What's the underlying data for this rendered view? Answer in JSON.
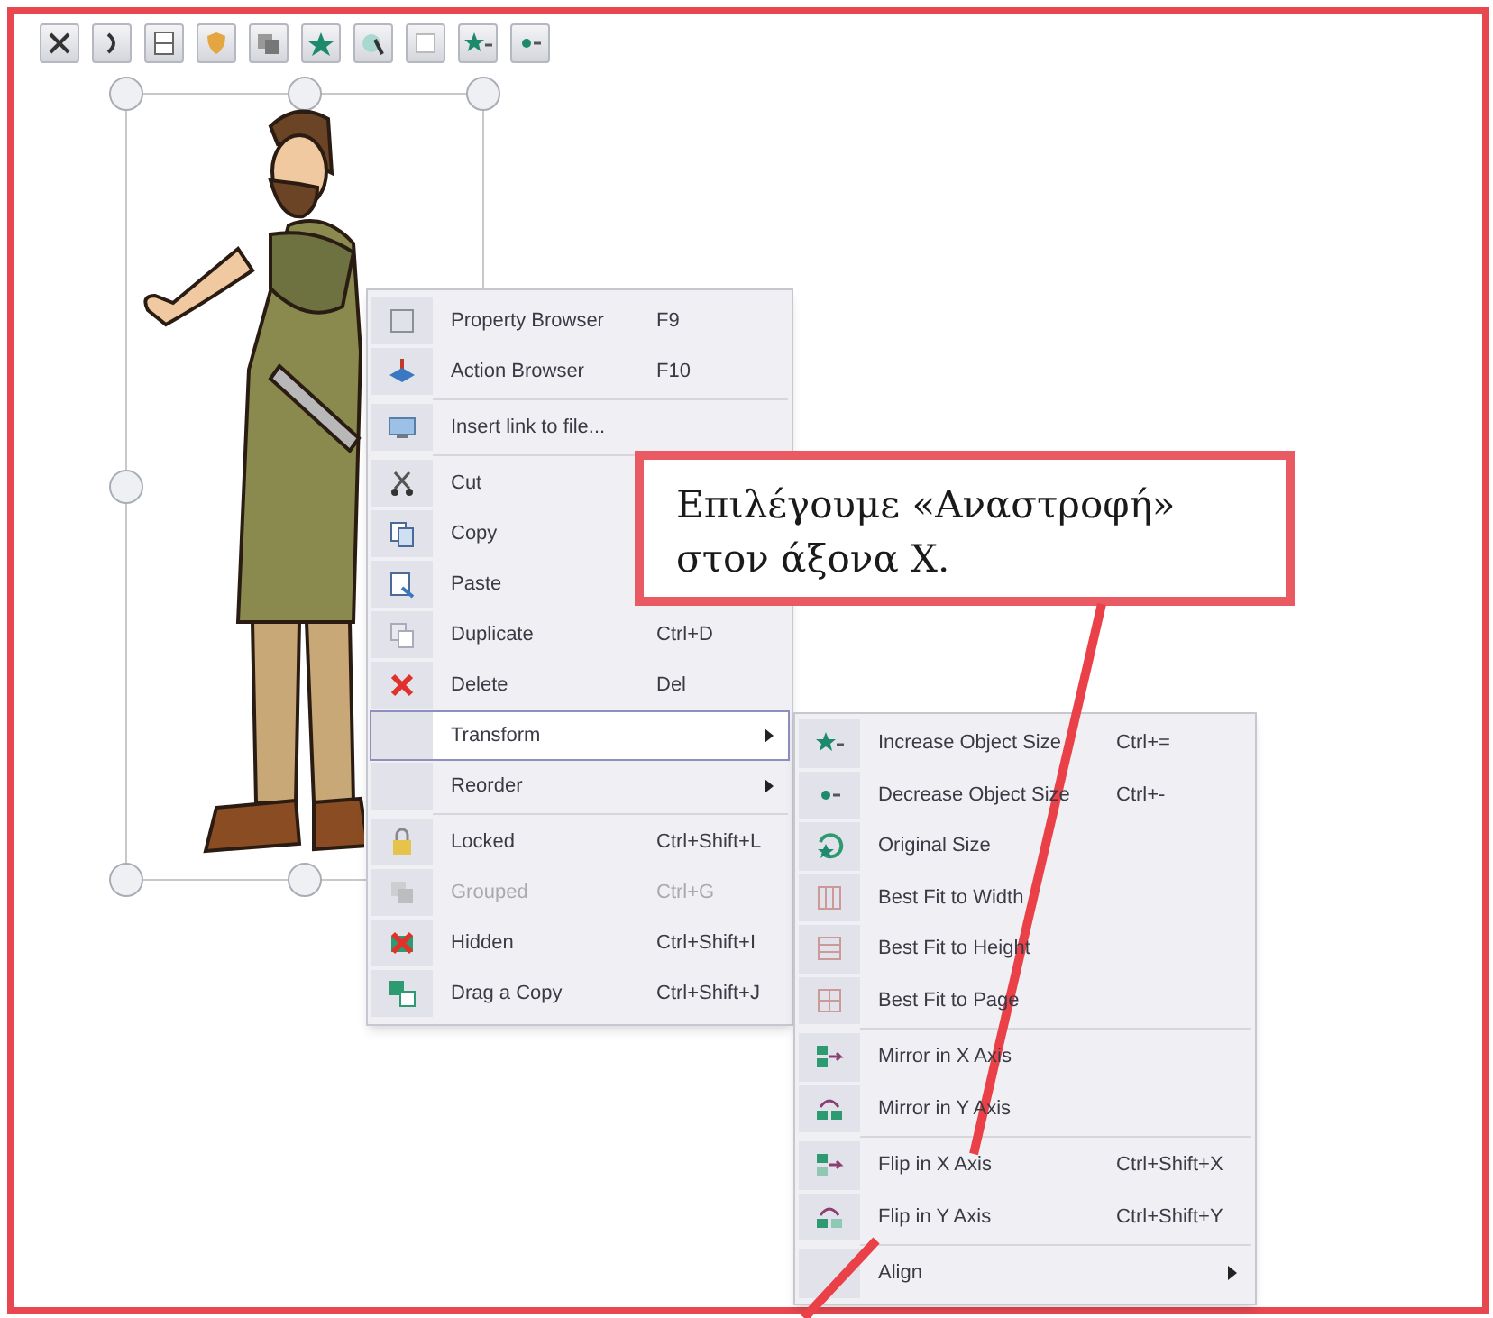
{
  "menu": {
    "items": [
      {
        "kind": "item",
        "label": "Property Browser",
        "shortcut": "F9",
        "disabled": false,
        "selected": false
      },
      {
        "kind": "item",
        "label": "Action Browser",
        "shortcut": "F10",
        "disabled": false,
        "selected": false
      },
      {
        "kind": "separator"
      },
      {
        "kind": "item",
        "label": "Insert link to file...",
        "disabled": false,
        "selected": false
      },
      {
        "kind": "separator"
      },
      {
        "kind": "item",
        "label": "Cut",
        "disabled": false,
        "selected": false
      },
      {
        "kind": "item",
        "label": "Copy",
        "disabled": false,
        "selected": false
      },
      {
        "kind": "item",
        "label": "Paste",
        "disabled": false,
        "selected": false
      },
      {
        "kind": "item",
        "label": "Duplicate",
        "shortcut": "Ctrl+D",
        "disabled": false,
        "selected": false
      },
      {
        "kind": "item",
        "label": "Delete",
        "shortcut": "Del",
        "disabled": false,
        "selected": false
      },
      {
        "kind": "item",
        "label": "Transform",
        "disabled": false,
        "selected": true,
        "submenu": true
      },
      {
        "kind": "item",
        "label": "Reorder",
        "disabled": false,
        "selected": false,
        "submenu": true
      },
      {
        "kind": "separator"
      },
      {
        "kind": "item",
        "label": "Locked",
        "shortcut": "Ctrl+Shift+L",
        "disabled": false,
        "selected": false
      },
      {
        "kind": "item",
        "label": "Grouped",
        "shortcut": "Ctrl+G",
        "disabled": true,
        "selected": false
      },
      {
        "kind": "item",
        "label": "Hidden",
        "shortcut": "Ctrl+Shift+I",
        "disabled": false,
        "selected": false
      },
      {
        "kind": "item",
        "label": "Drag a Copy",
        "shortcut": "Ctrl+Shift+J",
        "disabled": false,
        "selected": false
      }
    ]
  },
  "submenu": {
    "items": [
      {
        "kind": "item",
        "label": "Increase Object Size",
        "shortcut": "Ctrl+="
      },
      {
        "kind": "item",
        "label": "Decrease Object Size",
        "shortcut": "Ctrl+-"
      },
      {
        "kind": "item",
        "label": "Original Size"
      },
      {
        "kind": "item",
        "label": "Best Fit to Width"
      },
      {
        "kind": "item",
        "label": "Best Fit to Height"
      },
      {
        "kind": "item",
        "label": "Best Fit to Page"
      },
      {
        "kind": "separator"
      },
      {
        "kind": "item",
        "label": "Mirror in X Axis"
      },
      {
        "kind": "item",
        "label": "Mirror in Y Axis"
      },
      {
        "kind": "separator"
      },
      {
        "kind": "item",
        "label": "Flip in X Axis",
        "shortcut": "Ctrl+Shift+X"
      },
      {
        "kind": "item",
        "label": "Flip in Y Axis",
        "shortcut": "Ctrl+Shift+Y"
      },
      {
        "kind": "separator"
      },
      {
        "kind": "item",
        "label": "Align",
        "submenu": true
      }
    ]
  },
  "callout": {
    "lines": [
      "Επιλέγουμε «Αναστροφή»",
      "στον άξονα Χ."
    ]
  }
}
